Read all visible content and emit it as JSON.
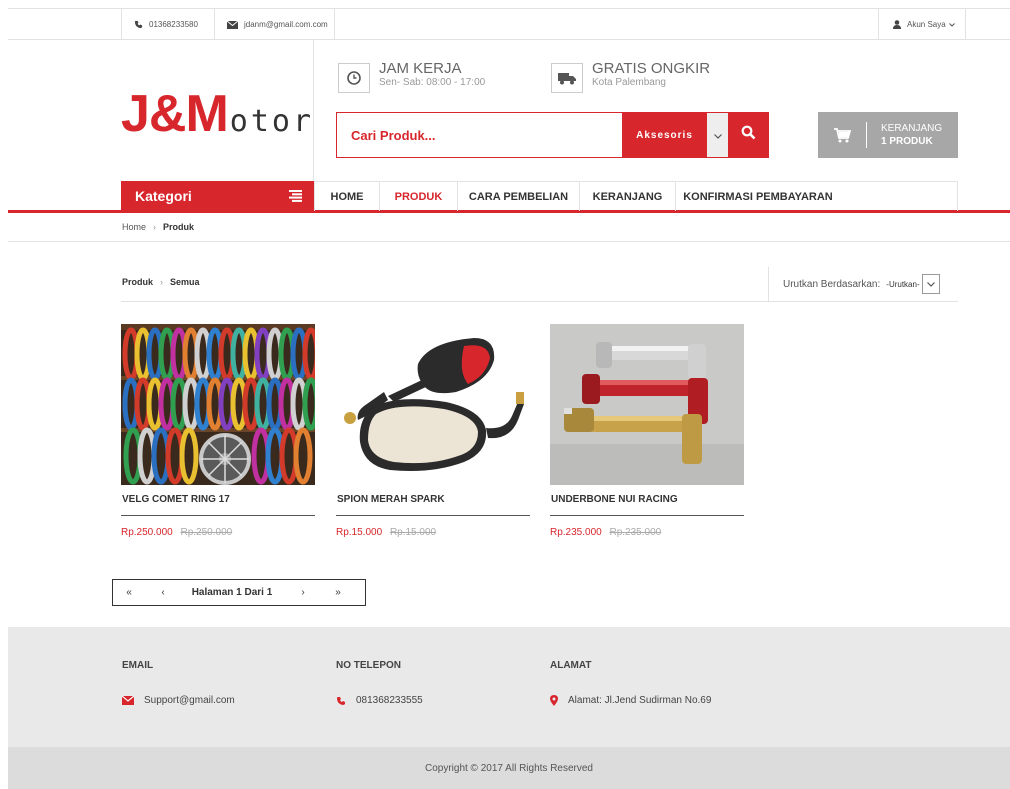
{
  "topbar": {
    "phone": "01368233580",
    "email": "jdanm@gmail.com.com",
    "account": "Akun Saya"
  },
  "brand": {
    "logo_big_1": "J&M",
    "logo_small": "otor"
  },
  "header": {
    "hours_title": "JAM KERJA",
    "hours_sub": "Sen- Sab: 08:00 - 17:00",
    "shipping_title": "GRATIS ONGKIR",
    "shipping_sub": "Kota Palembang"
  },
  "search": {
    "placeholder": "Cari Produk...",
    "category": "Aksesoris"
  },
  "cart": {
    "line1": "KERANJANG",
    "line2": "1 PRODUK"
  },
  "nav": {
    "kategori": "Kategori",
    "items": [
      {
        "label": "HOME",
        "active": false
      },
      {
        "label": "PRODUK",
        "active": true
      },
      {
        "label": "CARA PEMBELIAN",
        "active": false
      },
      {
        "label": "KERANJANG",
        "active": false
      },
      {
        "label": "KONFIRMASI PEMBAYARAN",
        "active": false
      }
    ]
  },
  "breadcrumb": {
    "home": "Home",
    "current": "Produk"
  },
  "listing": {
    "crumb_root": "Produk",
    "crumb_current": "Semua",
    "sort_label": "Urutkan Berdasarkan:",
    "sort_value": "-Urutkan-"
  },
  "products": [
    {
      "name": "VELG COMET RING 17",
      "price": "Rp.250.000",
      "old_price": "Rp.250.000"
    },
    {
      "name": "SPION MERAH SPARK",
      "price": "Rp.15.000",
      "old_price": "Rp.15.000"
    },
    {
      "name": "UNDERBONE NUI RACING",
      "price": "Rp.235.000",
      "old_price": "Rp.235.000"
    }
  ],
  "pager": {
    "first": "«",
    "prev": "‹",
    "label": "Halaman 1 Dari 1",
    "next": "›",
    "last": "»"
  },
  "footer": {
    "email_head": "EMAIL",
    "email_value": "Support@gmail.com",
    "phone_head": "NO TELEPON",
    "phone_value": "081368233555",
    "address_head": "ALAMAT",
    "address_value": "Alamat: Jl.Jend Sudirman No.69",
    "copyright": "Copyright © 2017 All Rights Reserved"
  },
  "colors": {
    "accent": "#d7262c",
    "cart_bg": "#a7a7a7",
    "footer_bg": "#e9e9e9"
  }
}
